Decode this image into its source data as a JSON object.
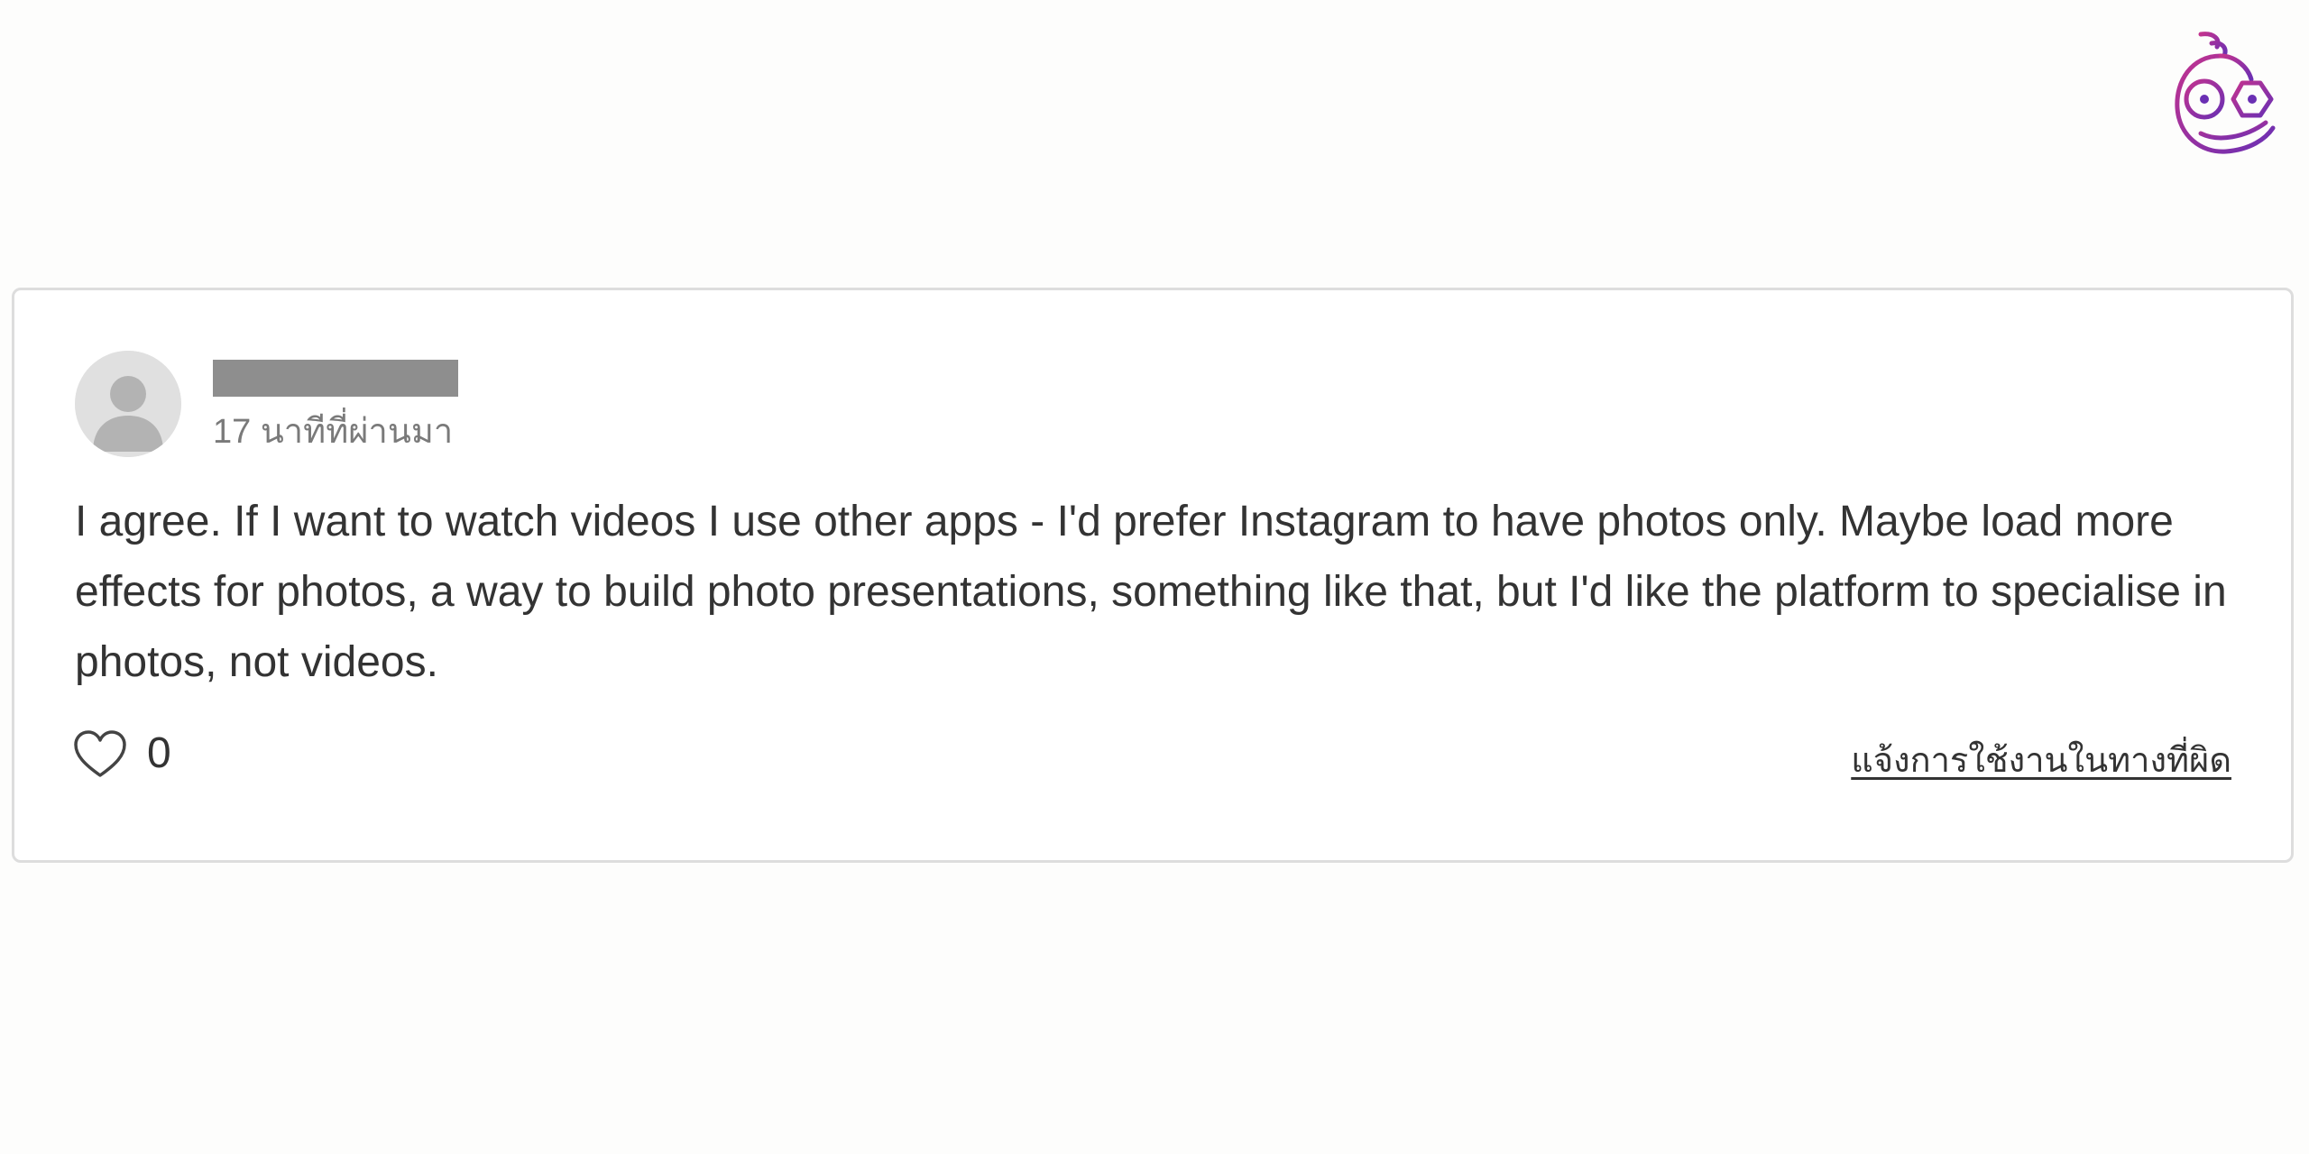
{
  "brand": {
    "logo_icon": "owl-with-glasses-logo",
    "logo_colors": [
      "#c2338f",
      "#6a2fb3"
    ]
  },
  "comment": {
    "avatar_icon": "default-user-avatar-icon",
    "username_redacted": true,
    "timestamp": "17 นาทีที่ผ่านมา",
    "text": "I agree. If I want to watch videos I use other apps - I'd prefer Instagram to have photos only. Maybe load more effects for photos, a way to build photo presentations, something like that, but I'd like the platform to specialise in photos, not videos.",
    "like_icon": "heart-outline-icon",
    "like_count": "0",
    "report_label": "แจ้งการใช้งานในทางที่ผิด"
  }
}
